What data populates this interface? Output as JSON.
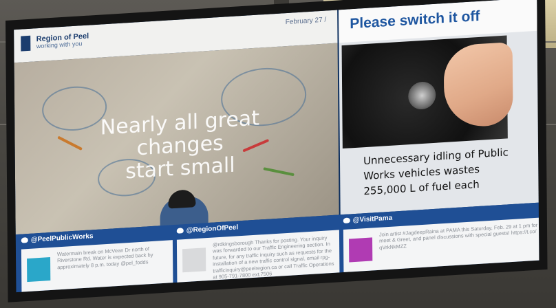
{
  "signage": {
    "brand": "Region of Peel",
    "brand_tagline": "working with you",
    "date": "February 27 /",
    "hero_caption_line1": "Nearly all great changes",
    "hero_caption_line2": "start small",
    "right_title": "Please switch it off",
    "idle_message_line1": "Unnecessary idling of Public",
    "idle_message_line2": "Works vehicles wastes",
    "idle_message_line3": "255,000 L of fuel each"
  },
  "tweets": [
    {
      "handle": "@PeelPublicWorks",
      "text": "Watermain break on McVean Dr north of Riverstone Rd. Water is expected back by approximately 8 p.m. today @pel_fodds",
      "image_color": "#2aa7c9"
    },
    {
      "handle": "@RegionOfPeel",
      "text": "@rdkingsborough Thanks for posting. Your inquiry was forwarded to our Traffic Engineering section. In future, for any traffic inquiry such as requests for the installation of a new traffic control signal, email rpg-trafficinquiry@peelregion.ca or call Traffic Operations at 905-791-7800 ext.7506",
      "image_color": "#d9dadc"
    },
    {
      "handle": "@VisitPama",
      "text": "Join artist #JagdeepRaina at PAMA this Saturday, Feb. 29 at 1 pm for a meet & Greet, and panel discussions with special guests! https://t.co/ qVrkNkMZZ",
      "image_color": "#b03bb3"
    }
  ]
}
